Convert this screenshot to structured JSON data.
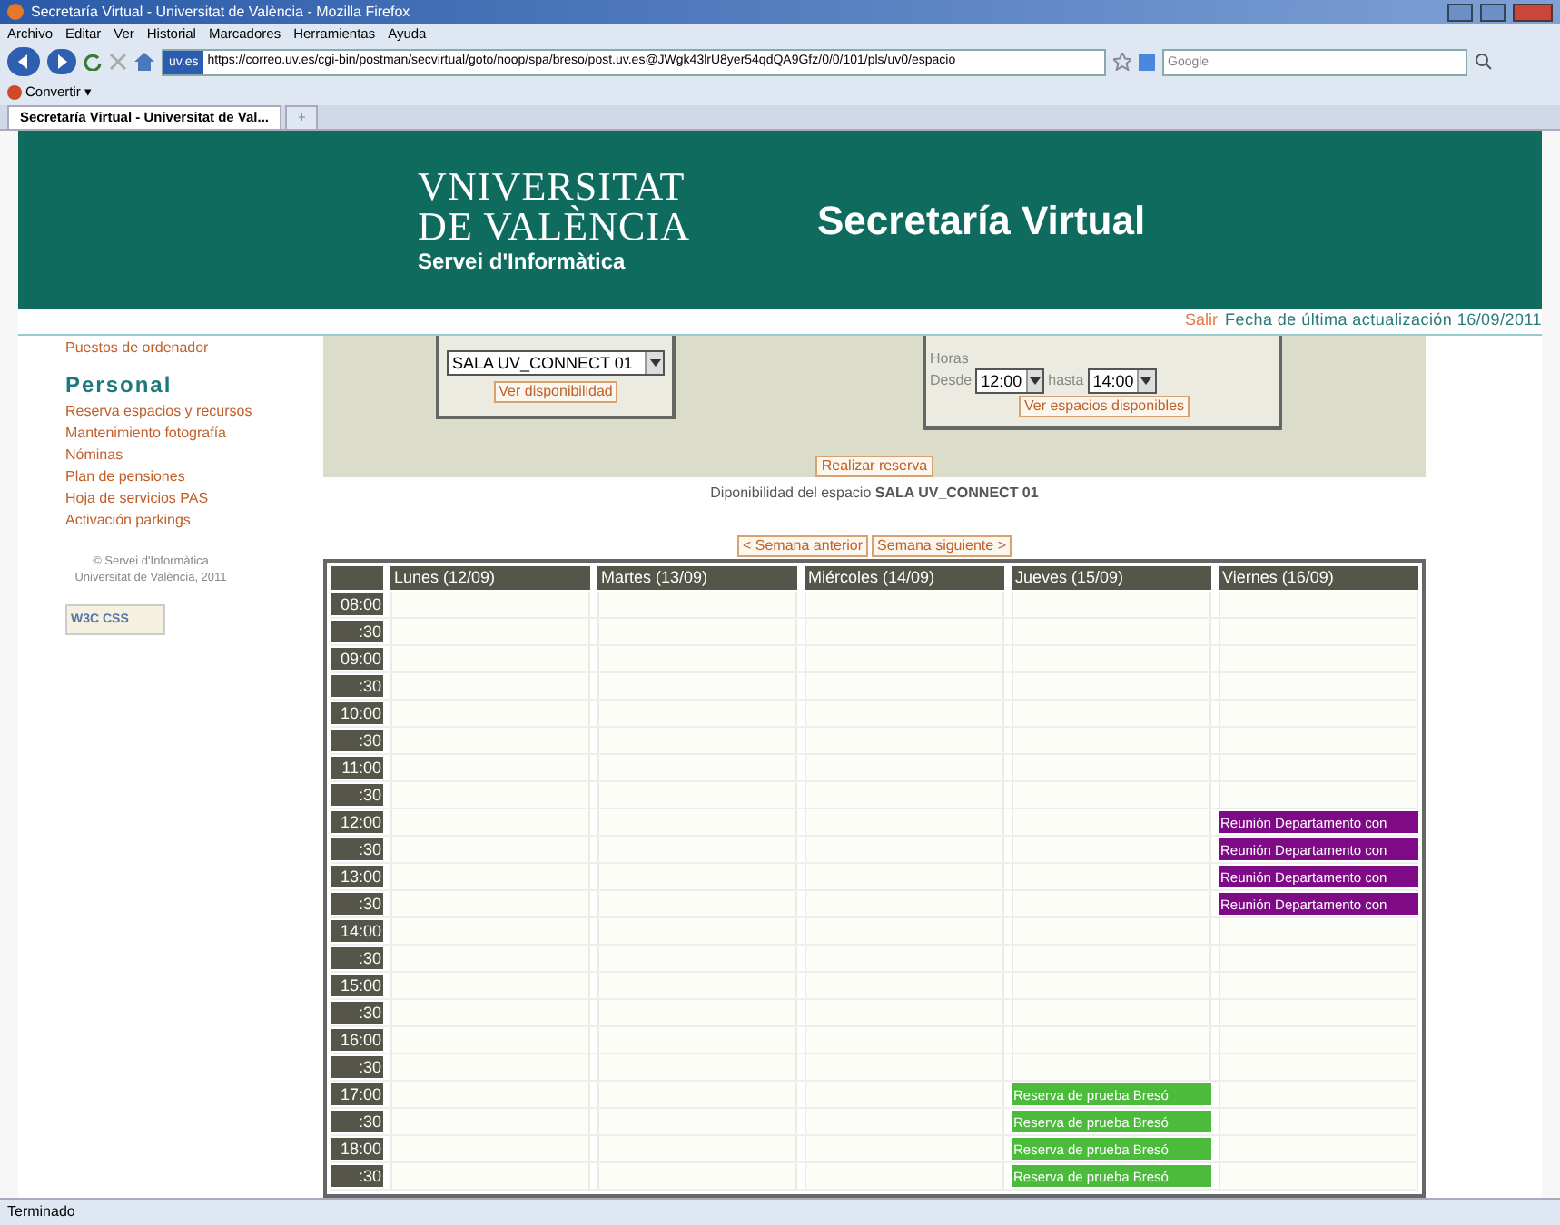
{
  "window": {
    "title": "Secretaría Virtual - Universitat de València - Mozilla Firefox"
  },
  "menu": [
    "Archivo",
    "Editar",
    "Ver",
    "Historial",
    "Marcadores",
    "Herramientas",
    "Ayuda"
  ],
  "nav": {
    "site_badge": "uv.es",
    "url": "https://correo.uv.es/cgi-bin/postman/secvirtual/goto/noop/spa/breso/post.uv.es@JWgk43lrU8yer54qdQA9Gfz/0/0/101/pls/uv0/espacio",
    "search_placeholder": "Google"
  },
  "bookmarks": [
    "Convertir ▾"
  ],
  "tabs": [
    {
      "label": "Secretaría Virtual - Universitat de Val...",
      "selected": true
    },
    {
      "label": "+",
      "selected": false
    }
  ],
  "header": {
    "logo_lines": [
      "VNIVERSITAT",
      "DE VALÈNCIA",
      "Servei d'Informàtica"
    ],
    "title": "Secretaría Virtual"
  },
  "topline": {
    "logout": "Salir",
    "updated": "Fecha de última actualización 16/09/2011"
  },
  "sidebar": {
    "top_item": "Puestos de ordenador",
    "section": "Personal",
    "items": [
      "Reserva espacios y recursos",
      "Mantenimiento fotografía",
      "Nóminas",
      "Plan de pensiones",
      "Hoja de servicios PAS",
      "Activación parkings"
    ],
    "footer": [
      "© Servei d'Informàtica",
      "Universitat de València, 2011"
    ],
    "badge": "W3C CSS"
  },
  "form": {
    "space_select": "SALA UV_CONNECT 01",
    "space_button": "Ver disponibilidad",
    "hours_label": "Horas",
    "from_label": "Desde",
    "from_value": "12:00",
    "to_label": "hasta",
    "to_value": "14:00",
    "spaces_button": "Ver espacios disponibles",
    "submit_button": "Realizar reserva"
  },
  "availability_text": "Diponibilidad del espacio **SALA UV_CONNECT 01**",
  "week_nav": [
    "< Semana anterior",
    "Semana siguiente >"
  ],
  "calendar": {
    "days": [
      "Lunes (12/09)",
      "Martes (13/09)",
      "Miércoles (14/09)",
      "Jueves (15/09)",
      "Viernes (16/09)"
    ],
    "rows": [
      {
        "time": "08:00",
        "cells": [
          {
            "kind": "free"
          },
          {
            "kind": "free"
          },
          {
            "kind": "free"
          },
          {
            "kind": "free"
          },
          {
            "kind": "free"
          }
        ]
      },
      {
        "time": ":30",
        "cells": [
          {
            "kind": "free"
          },
          {
            "kind": "free"
          },
          {
            "kind": "free"
          },
          {
            "kind": "free"
          },
          {
            "kind": "free"
          }
        ]
      },
      {
        "time": "09:00",
        "cells": [
          {
            "kind": "free"
          },
          {
            "kind": "free"
          },
          {
            "kind": "free"
          },
          {
            "kind": "free"
          },
          {
            "kind": "free"
          }
        ]
      },
      {
        "time": ":30",
        "cells": [
          {
            "kind": "free"
          },
          {
            "kind": "free"
          },
          {
            "kind": "free"
          },
          {
            "kind": "free"
          },
          {
            "kind": "free"
          }
        ]
      },
      {
        "time": "10:00",
        "cells": [
          {
            "kind": "free"
          },
          {
            "kind": "free"
          },
          {
            "kind": "free"
          },
          {
            "kind": "free"
          },
          {
            "kind": "free"
          }
        ]
      },
      {
        "time": ":30",
        "cells": [
          {
            "kind": "free"
          },
          {
            "kind": "free"
          },
          {
            "kind": "free"
          },
          {
            "kind": "free"
          },
          {
            "kind": "free"
          }
        ]
      },
      {
        "time": "11:00",
        "cells": [
          {
            "kind": "free"
          },
          {
            "kind": "free"
          },
          {
            "kind": "free"
          },
          {
            "kind": "free"
          },
          {
            "kind": "free"
          }
        ]
      },
      {
        "time": ":30",
        "cells": [
          {
            "kind": "free"
          },
          {
            "kind": "free"
          },
          {
            "kind": "free"
          },
          {
            "kind": "free"
          },
          {
            "kind": "free"
          }
        ]
      },
      {
        "time": "12:00",
        "cells": [
          {
            "kind": "free"
          },
          {
            "kind": "free"
          },
          {
            "kind": "free"
          },
          {
            "kind": "free"
          },
          {
            "kind": "booked",
            "text": "Reunión Departamento con",
            "color": "#7e0a86"
          }
        ]
      },
      {
        "time": ":30",
        "cells": [
          {
            "kind": "free"
          },
          {
            "kind": "free"
          },
          {
            "kind": "free"
          },
          {
            "kind": "free"
          },
          {
            "kind": "booked",
            "text": "Reunión Departamento con",
            "color": "#7e0a86"
          }
        ]
      },
      {
        "time": "13:00",
        "cells": [
          {
            "kind": "free"
          },
          {
            "kind": "free"
          },
          {
            "kind": "free"
          },
          {
            "kind": "free"
          },
          {
            "kind": "booked",
            "text": "Reunión Departamento con",
            "color": "#7e0a86"
          }
        ]
      },
      {
        "time": ":30",
        "cells": [
          {
            "kind": "free"
          },
          {
            "kind": "free"
          },
          {
            "kind": "free"
          },
          {
            "kind": "free"
          },
          {
            "kind": "booked",
            "text": "Reunión Departamento con",
            "color": "#7e0a86"
          }
        ]
      },
      {
        "time": "14:00",
        "cells": [
          {
            "kind": "free"
          },
          {
            "kind": "free"
          },
          {
            "kind": "free"
          },
          {
            "kind": "free"
          },
          {
            "kind": "free"
          }
        ]
      },
      {
        "time": ":30",
        "cells": [
          {
            "kind": "free"
          },
          {
            "kind": "free"
          },
          {
            "kind": "free"
          },
          {
            "kind": "free"
          },
          {
            "kind": "free"
          }
        ]
      },
      {
        "time": "15:00",
        "cells": [
          {
            "kind": "free"
          },
          {
            "kind": "free"
          },
          {
            "kind": "free"
          },
          {
            "kind": "free"
          },
          {
            "kind": "free"
          }
        ]
      },
      {
        "time": ":30",
        "cells": [
          {
            "kind": "free"
          },
          {
            "kind": "free"
          },
          {
            "kind": "free"
          },
          {
            "kind": "free"
          },
          {
            "kind": "free"
          }
        ]
      },
      {
        "time": "16:00",
        "cells": [
          {
            "kind": "free"
          },
          {
            "kind": "free"
          },
          {
            "kind": "free"
          },
          {
            "kind": "free"
          },
          {
            "kind": "free"
          }
        ]
      },
      {
        "time": ":30",
        "cells": [
          {
            "kind": "free"
          },
          {
            "kind": "free"
          },
          {
            "kind": "free"
          },
          {
            "kind": "free"
          },
          {
            "kind": "free"
          }
        ]
      },
      {
        "time": "17:00",
        "cells": [
          {
            "kind": "free"
          },
          {
            "kind": "free"
          },
          {
            "kind": "free"
          },
          {
            "kind": "booked",
            "text": "Reserva de prueba Bresó",
            "color": "#4cbb3c"
          },
          {
            "kind": "free"
          }
        ]
      },
      {
        "time": ":30",
        "cells": [
          {
            "kind": "free"
          },
          {
            "kind": "free"
          },
          {
            "kind": "free"
          },
          {
            "kind": "booked",
            "text": "Reserva de prueba Bresó",
            "color": "#4cbb3c"
          },
          {
            "kind": "free"
          }
        ]
      },
      {
        "time": "18:00",
        "cells": [
          {
            "kind": "free"
          },
          {
            "kind": "free"
          },
          {
            "kind": "free"
          },
          {
            "kind": "booked",
            "text": "Reserva de prueba Bresó",
            "color": "#4cbb3c"
          },
          {
            "kind": "free"
          }
        ]
      },
      {
        "time": ":30",
        "cells": [
          {
            "kind": "free"
          },
          {
            "kind": "free"
          },
          {
            "kind": "free"
          },
          {
            "kind": "booked",
            "text": "Reserva de prueba Bresó",
            "color": "#4cbb3c"
          },
          {
            "kind": "free"
          }
        ]
      }
    ]
  },
  "status_bar": "Terminado"
}
